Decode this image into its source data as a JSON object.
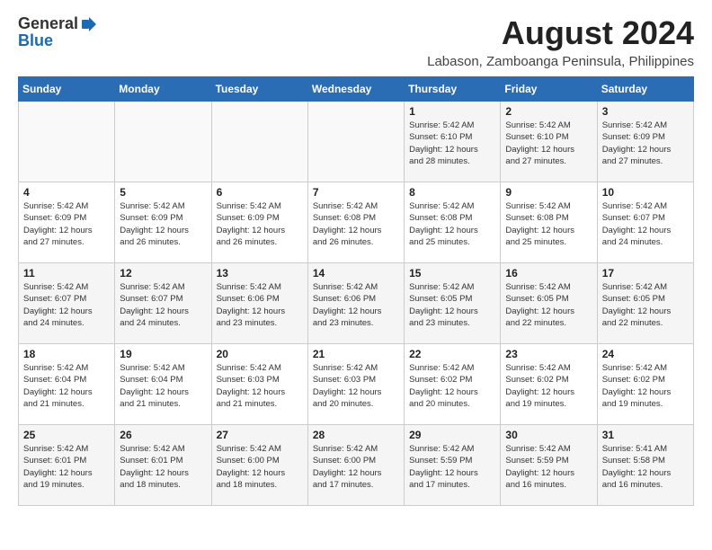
{
  "header": {
    "logo_general": "General",
    "logo_blue": "Blue",
    "main_title": "August 2024",
    "subtitle": "Labason, Zamboanga Peninsula, Philippines"
  },
  "calendar": {
    "days_of_week": [
      "Sunday",
      "Monday",
      "Tuesday",
      "Wednesday",
      "Thursday",
      "Friday",
      "Saturday"
    ],
    "weeks": [
      [
        {
          "day": "",
          "info": ""
        },
        {
          "day": "",
          "info": ""
        },
        {
          "day": "",
          "info": ""
        },
        {
          "day": "",
          "info": ""
        },
        {
          "day": "1",
          "info": "Sunrise: 5:42 AM\nSunset: 6:10 PM\nDaylight: 12 hours\nand 28 minutes."
        },
        {
          "day": "2",
          "info": "Sunrise: 5:42 AM\nSunset: 6:10 PM\nDaylight: 12 hours\nand 27 minutes."
        },
        {
          "day": "3",
          "info": "Sunrise: 5:42 AM\nSunset: 6:09 PM\nDaylight: 12 hours\nand 27 minutes."
        }
      ],
      [
        {
          "day": "4",
          "info": "Sunrise: 5:42 AM\nSunset: 6:09 PM\nDaylight: 12 hours\nand 27 minutes."
        },
        {
          "day": "5",
          "info": "Sunrise: 5:42 AM\nSunset: 6:09 PM\nDaylight: 12 hours\nand 26 minutes."
        },
        {
          "day": "6",
          "info": "Sunrise: 5:42 AM\nSunset: 6:09 PM\nDaylight: 12 hours\nand 26 minutes."
        },
        {
          "day": "7",
          "info": "Sunrise: 5:42 AM\nSunset: 6:08 PM\nDaylight: 12 hours\nand 26 minutes."
        },
        {
          "day": "8",
          "info": "Sunrise: 5:42 AM\nSunset: 6:08 PM\nDaylight: 12 hours\nand 25 minutes."
        },
        {
          "day": "9",
          "info": "Sunrise: 5:42 AM\nSunset: 6:08 PM\nDaylight: 12 hours\nand 25 minutes."
        },
        {
          "day": "10",
          "info": "Sunrise: 5:42 AM\nSunset: 6:07 PM\nDaylight: 12 hours\nand 24 minutes."
        }
      ],
      [
        {
          "day": "11",
          "info": "Sunrise: 5:42 AM\nSunset: 6:07 PM\nDaylight: 12 hours\nand 24 minutes."
        },
        {
          "day": "12",
          "info": "Sunrise: 5:42 AM\nSunset: 6:07 PM\nDaylight: 12 hours\nand 24 minutes."
        },
        {
          "day": "13",
          "info": "Sunrise: 5:42 AM\nSunset: 6:06 PM\nDaylight: 12 hours\nand 23 minutes."
        },
        {
          "day": "14",
          "info": "Sunrise: 5:42 AM\nSunset: 6:06 PM\nDaylight: 12 hours\nand 23 minutes."
        },
        {
          "day": "15",
          "info": "Sunrise: 5:42 AM\nSunset: 6:05 PM\nDaylight: 12 hours\nand 23 minutes."
        },
        {
          "day": "16",
          "info": "Sunrise: 5:42 AM\nSunset: 6:05 PM\nDaylight: 12 hours\nand 22 minutes."
        },
        {
          "day": "17",
          "info": "Sunrise: 5:42 AM\nSunset: 6:05 PM\nDaylight: 12 hours\nand 22 minutes."
        }
      ],
      [
        {
          "day": "18",
          "info": "Sunrise: 5:42 AM\nSunset: 6:04 PM\nDaylight: 12 hours\nand 21 minutes."
        },
        {
          "day": "19",
          "info": "Sunrise: 5:42 AM\nSunset: 6:04 PM\nDaylight: 12 hours\nand 21 minutes."
        },
        {
          "day": "20",
          "info": "Sunrise: 5:42 AM\nSunset: 6:03 PM\nDaylight: 12 hours\nand 21 minutes."
        },
        {
          "day": "21",
          "info": "Sunrise: 5:42 AM\nSunset: 6:03 PM\nDaylight: 12 hours\nand 20 minutes."
        },
        {
          "day": "22",
          "info": "Sunrise: 5:42 AM\nSunset: 6:02 PM\nDaylight: 12 hours\nand 20 minutes."
        },
        {
          "day": "23",
          "info": "Sunrise: 5:42 AM\nSunset: 6:02 PM\nDaylight: 12 hours\nand 19 minutes."
        },
        {
          "day": "24",
          "info": "Sunrise: 5:42 AM\nSunset: 6:02 PM\nDaylight: 12 hours\nand 19 minutes."
        }
      ],
      [
        {
          "day": "25",
          "info": "Sunrise: 5:42 AM\nSunset: 6:01 PM\nDaylight: 12 hours\nand 19 minutes."
        },
        {
          "day": "26",
          "info": "Sunrise: 5:42 AM\nSunset: 6:01 PM\nDaylight: 12 hours\nand 18 minutes."
        },
        {
          "day": "27",
          "info": "Sunrise: 5:42 AM\nSunset: 6:00 PM\nDaylight: 12 hours\nand 18 minutes."
        },
        {
          "day": "28",
          "info": "Sunrise: 5:42 AM\nSunset: 6:00 PM\nDaylight: 12 hours\nand 17 minutes."
        },
        {
          "day": "29",
          "info": "Sunrise: 5:42 AM\nSunset: 5:59 PM\nDaylight: 12 hours\nand 17 minutes."
        },
        {
          "day": "30",
          "info": "Sunrise: 5:42 AM\nSunset: 5:59 PM\nDaylight: 12 hours\nand 16 minutes."
        },
        {
          "day": "31",
          "info": "Sunrise: 5:41 AM\nSunset: 5:58 PM\nDaylight: 12 hours\nand 16 minutes."
        }
      ]
    ]
  }
}
